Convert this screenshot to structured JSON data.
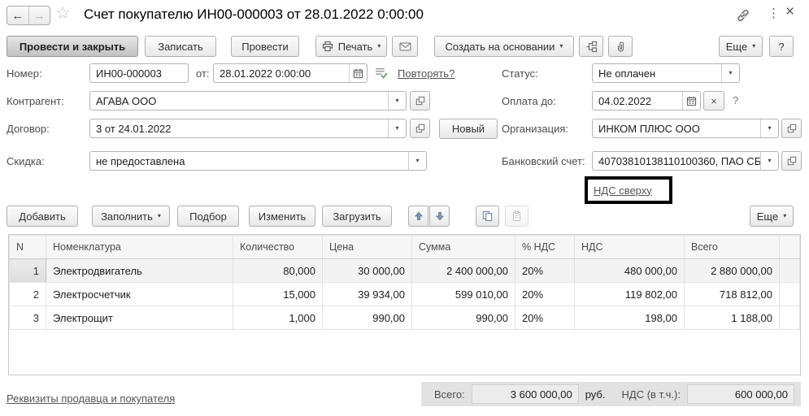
{
  "window": {
    "title": "Счет покупателю ИН00-000003 от 28.01.2022 0:00:00",
    "back_glyph": "←",
    "forward_glyph": "→",
    "star_glyph": "☆",
    "menu_dots_glyph": "⋮",
    "close_glyph": "×"
  },
  "toolbar": {
    "post_and_close": "Провести и закрыть",
    "save": "Записать",
    "post": "Провести",
    "print": "Печать",
    "create_based_on": "Создать на основании",
    "more": "Еще",
    "help": "?"
  },
  "form": {
    "number": {
      "label": "Номер:",
      "value": "ИН00-000003",
      "from_label": "от:",
      "date_value": "28.01.2022 0:00:00",
      "repeat_link": "Повторять?"
    },
    "counterparty": {
      "label": "Контрагент:",
      "value": "АГАВА ООО"
    },
    "contract": {
      "label": "Договор:",
      "value": "3 от 24.01.2022",
      "new_button": "Новый"
    },
    "discount": {
      "label": "Скидка:",
      "value": "не предоставлена"
    },
    "status": {
      "label": "Статус:",
      "value": "Не оплачен"
    },
    "pay_until": {
      "label": "Оплата до:",
      "value": "04.02.2022",
      "hint": "?"
    },
    "organization": {
      "label": "Организация:",
      "value": "ИНКОМ ПЛЮС ООО"
    },
    "bank_account": {
      "label": "Банковский счет:",
      "value": "40703810138110100360, ПАО СБ"
    },
    "vat_mode_link": "НДС сверху"
  },
  "table_toolbar": {
    "add": "Добавить",
    "fill": "Заполнить",
    "pick": "Подбор",
    "edit": "Изменить",
    "load": "Загрузить",
    "more": "Еще"
  },
  "table": {
    "headers": [
      "N",
      "Номенклатура",
      "Количество",
      "Цена",
      "Сумма",
      "% НДС",
      "НДС",
      "Всего"
    ],
    "rows": [
      {
        "n": "1",
        "name": "Электродвигатель",
        "qty": "80,000",
        "price": "30 000,00",
        "sum": "2 400 000,00",
        "vat_percent": "20%",
        "vat": "480 000,00",
        "total": "2 880 000,00"
      },
      {
        "n": "2",
        "name": "Электросчетчик",
        "qty": "15,000",
        "price": "39 934,00",
        "sum": "599 010,00",
        "vat_percent": "20%",
        "vat": "119 802,00",
        "total": "718 812,00"
      },
      {
        "n": "3",
        "name": "Электрощит",
        "qty": "1,000",
        "price": "990,00",
        "sum": "990,00",
        "vat_percent": "20%",
        "vat": "198,00",
        "total": "1 188,00"
      }
    ]
  },
  "footer": {
    "details_link": "Реквизиты продавца и покупателя",
    "total_label": "Всего:",
    "total_value": "3 600 000,00",
    "currency": "руб.",
    "vat_label": "НДС (в т.ч.):",
    "vat_value": "600 000,00"
  },
  "colors": {
    "highlight_box": "#000000",
    "totals_bar_bg": "#e2e2e2",
    "primary_button_bg": "#d4d4d4",
    "link_color": "#545454",
    "selected_row_bg": "#f3f3f3"
  }
}
